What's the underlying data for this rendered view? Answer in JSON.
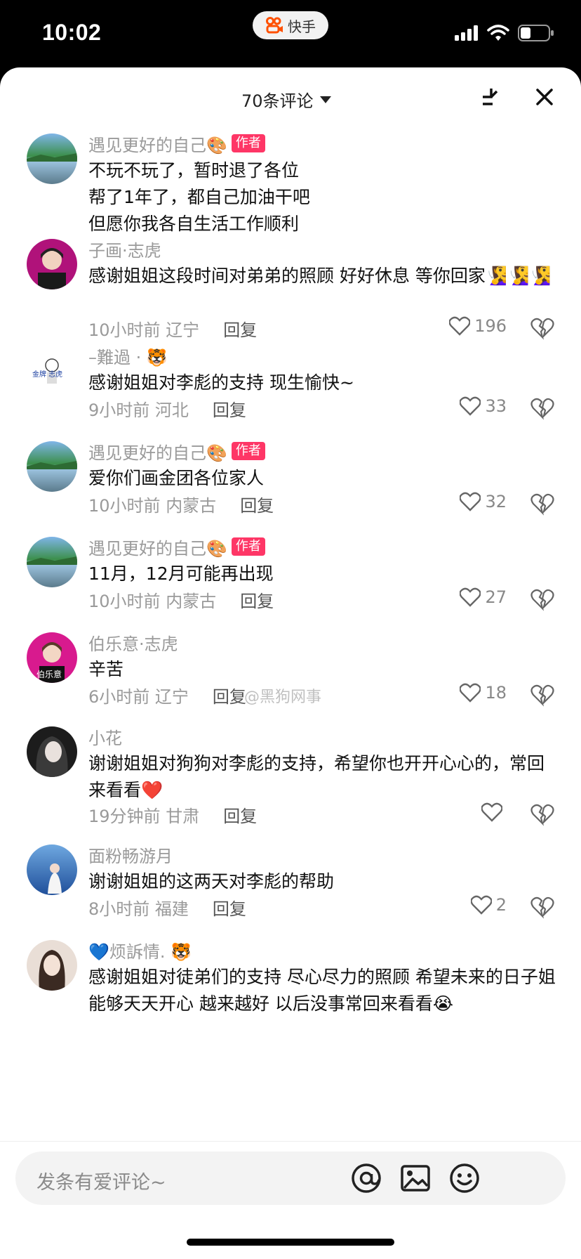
{
  "status_bar": {
    "time": "10:02",
    "app_name": "快手"
  },
  "header": {
    "comment_count_label": "70条评论"
  },
  "comments": [
    {
      "name": "遇见更好的自己🎨",
      "tag": "作者",
      "text": "不玩不玩了，暂时退了各位\n帮了1年了，都自己加油干吧\n但愿你我各自生活工作顺利",
      "time": "",
      "location": "",
      "reply": "",
      "likes": ""
    },
    {
      "name": "子画·志虎",
      "tag": "",
      "text": "感谢姐姐这段时间对弟弟的照顾 好好休息 等你回家🧏‍♀️🧏‍♀️🧏‍♀️",
      "time": "10小时前",
      "location": "辽宁",
      "reply": "回复",
      "likes": "196"
    },
    {
      "name": "–難過 · 🐯",
      "tag": "",
      "text": "感谢姐姐对李彪的支持 现生愉快~",
      "time": "9小时前",
      "location": "河北",
      "reply": "回复",
      "likes": "33"
    },
    {
      "name": "遇见更好的自己🎨",
      "tag": "作者",
      "text": "爱你们画金团各位家人",
      "time": "10小时前",
      "location": "内蒙古",
      "reply": "回复",
      "likes": "32"
    },
    {
      "name": "遇见更好的自己🎨",
      "tag": "作者",
      "text": "11月，12月可能再出现",
      "time": "10小时前",
      "location": "内蒙古",
      "reply": "回复",
      "likes": "27"
    },
    {
      "name": "伯乐意·志虎",
      "tag": "",
      "text": "辛苦",
      "time": "6小时前",
      "location": "辽宁",
      "reply": "回复",
      "likes": "18"
    },
    {
      "name": "小花",
      "tag": "",
      "text": "谢谢姐姐对狗狗对李彪的支持，希望你也开开心心的，常回来看看❤️",
      "time": "19分钟前",
      "location": "甘肃",
      "reply": "回复",
      "likes": ""
    },
    {
      "name": "面粉畅游月",
      "tag": "",
      "text": "谢谢姐姐的这两天对李彪的帮助",
      "time": "8小时前",
      "location": "福建",
      "reply": "回复",
      "likes": "2"
    },
    {
      "name": "💙烦訴情. 🐯",
      "tag": "",
      "text": "感谢姐姐对徒弟们的支持 尽心尽力的照顾 希望未来的日子姐能够天天开心 越来越好 以后没事常回来看看😭",
      "time": "",
      "location": "",
      "reply": "",
      "likes": ""
    }
  ],
  "avatar_labels": {
    "zihua": "子画",
    "kinfan": "金牌 志虎",
    "bole": "伯乐意"
  },
  "watermark": "@黑狗网事",
  "input": {
    "placeholder": "发条有爱评论~"
  },
  "colors": {
    "author_tag": "#fe3666",
    "background": "#ffffff",
    "status_bar": "#000000"
  },
  "icons": [
    "dropdown-triangle-icon",
    "collapse-icon",
    "close-icon",
    "heart-icon",
    "broken-heart-icon",
    "at-icon",
    "image-icon",
    "emoji-icon"
  ]
}
